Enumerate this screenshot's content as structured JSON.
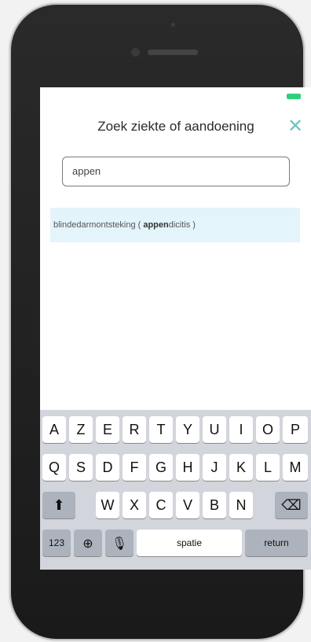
{
  "header": {
    "title": "Zoek ziekte of aandoening"
  },
  "search": {
    "value": "appen"
  },
  "results": [
    {
      "prefix": "blindedarmontsteking ( ",
      "match": "appen",
      "suffix": "dicitis )"
    }
  ],
  "keyboard": {
    "row1": [
      "A",
      "Z",
      "E",
      "R",
      "T",
      "Y",
      "U",
      "I",
      "O",
      "P"
    ],
    "row2": [
      "Q",
      "S",
      "D",
      "F",
      "G",
      "H",
      "J",
      "K",
      "L",
      "M"
    ],
    "row3": [
      "W",
      "X",
      "C",
      "V",
      "B",
      "N"
    ],
    "numbers_label": "123",
    "space_label": "spatie",
    "return_label": "return"
  },
  "colors": {
    "accent": "#6fc6c0",
    "battery": "#2fd07a",
    "result_bg": "#e4f4fb"
  },
  "icons": [
    "close-icon",
    "shift-icon",
    "backspace-icon",
    "globe-icon",
    "microphone-icon",
    "battery-icon"
  ]
}
